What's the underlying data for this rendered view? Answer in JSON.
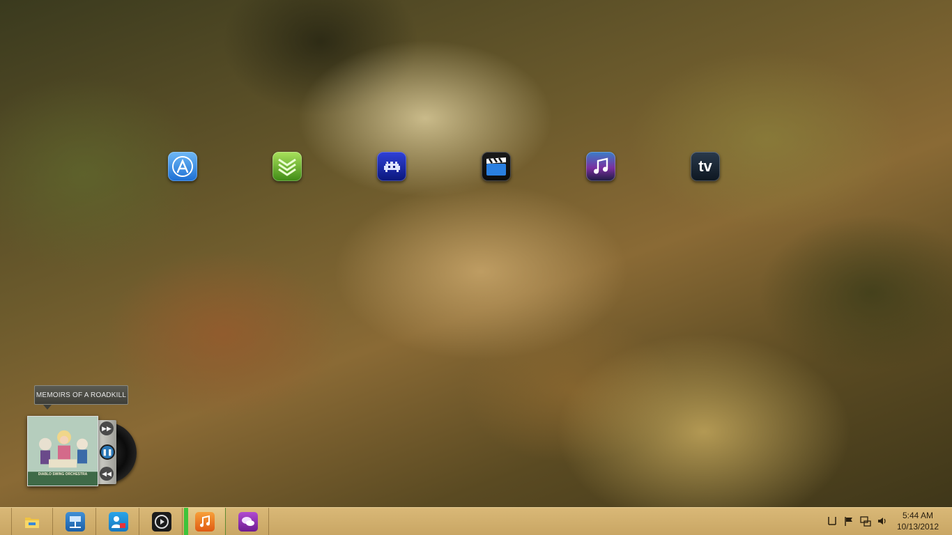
{
  "desktop": {
    "icons": [
      {
        "name": "app-store-icon"
      },
      {
        "name": "stacks-download-icon"
      },
      {
        "name": "space-invader-icon"
      },
      {
        "name": "movie-clapper-icon"
      },
      {
        "name": "itunes-music-icon"
      },
      {
        "name": "tv-app-icon",
        "label": "tv"
      }
    ]
  },
  "music_widget": {
    "track_title": "MEMOIRS OF A ROADKILL",
    "album_band_text": "DIABLO SWING ORCHESTRA",
    "accent_color": "#2a78b8"
  },
  "taskbar": {
    "buttons": [
      {
        "name": "file-explorer-icon"
      },
      {
        "name": "network-icon"
      },
      {
        "name": "people-icon"
      },
      {
        "name": "media-player-icon"
      },
      {
        "name": "itunes-icon",
        "active": true,
        "active_color": "#3ec43a"
      },
      {
        "name": "chat-icon"
      }
    ],
    "tray": [
      "pin-icon",
      "flag-icon",
      "network-status-icon",
      "volume-icon"
    ],
    "clock": {
      "time": "5:44 AM",
      "date": "10/13/2012"
    }
  }
}
